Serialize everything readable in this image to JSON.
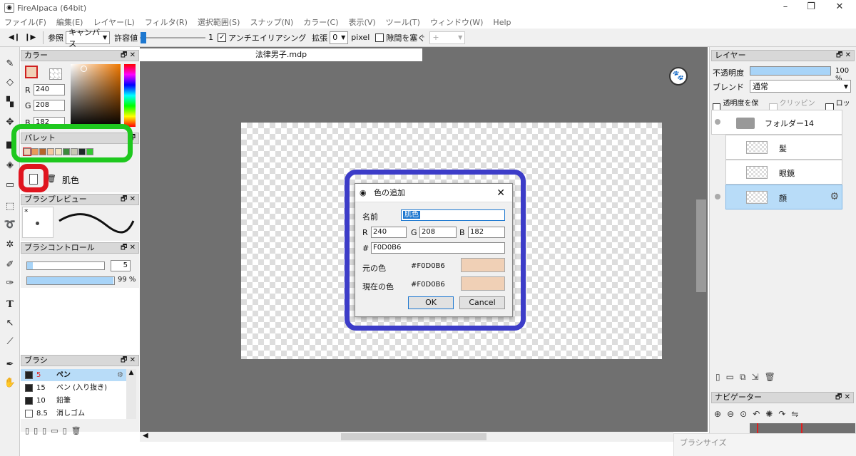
{
  "window": {
    "title": "FireAlpaca (64bit)"
  },
  "menu": [
    "ファイル(F)",
    "編集(E)",
    "レイヤー(L)",
    "フィルタ(R)",
    "選択範囲(S)",
    "スナップ(N)",
    "カラー(C)",
    "表示(V)",
    "ツール(T)",
    "ウィンドウ(W)",
    "Help"
  ],
  "toolbar": {
    "ref_label": "参照",
    "ref_value": "キャンバス",
    "tolerance_label": "許容値",
    "tolerance_value": "1",
    "tolerance_level": 0.01,
    "antialias_label": "アンチエイリアシング",
    "antialias_checked": true,
    "expand_label": "拡張",
    "expand_value": "0",
    "expand_unit": "pixel",
    "gap_label": "隙間を塞ぐ",
    "gap_checked": false,
    "gap_value": "+"
  },
  "document": {
    "tab": "法律男子.mdp"
  },
  "color_panel": {
    "title": "カラー",
    "r_label": "R",
    "r": "240",
    "g_label": "G",
    "g": "208",
    "b_label": "B",
    "b": "182",
    "fg_color": "#F0D0B6"
  },
  "palette_panel": {
    "title": "パレット",
    "colors": [
      "#F0D0B6",
      "#E89A5A",
      "#B5652A",
      "#F5C8A0",
      "#F2E4C0",
      "#3C8A3C",
      "#C8C8B4",
      "#1E2A28",
      "#34C832"
    ],
    "selected_name": "肌色"
  },
  "brush_preview_panel": {
    "title": "ブラシプレビュー",
    "size_mark": "*"
  },
  "brush_control_panel": {
    "title": "ブラシコントロール",
    "size": "5",
    "size_level": 0.05,
    "opacity": "99 %",
    "opacity_level": 0.99
  },
  "brush_panel": {
    "title": "ブラシ",
    "items": [
      {
        "size": "5",
        "name": "ペン",
        "color": "#222222",
        "selected": true
      },
      {
        "size": "15",
        "name": "ペン (入り抜き)",
        "color": "#222222",
        "selected": false
      },
      {
        "size": "10",
        "name": "鉛筆",
        "color": "#222222",
        "selected": false
      },
      {
        "size": "8.5",
        "name": "消しゴム",
        "color": "#ffffff",
        "selected": false
      }
    ]
  },
  "dialog": {
    "title": "色の追加",
    "name_label": "名前",
    "name_value": "肌色",
    "r_label": "R",
    "r": "240",
    "g_label": "G",
    "g": "208",
    "b_label": "B",
    "b": "182",
    "hex_label": "#",
    "hex_value": "F0D0B6",
    "original_label": "元の色",
    "original_value": "#F0D0B6",
    "current_label": "現在の色",
    "current_value": "#F0D0B6",
    "swatch_color": "#F0D0B6",
    "ok": "OK",
    "cancel": "Cancel"
  },
  "layer_panel": {
    "title": "レイヤー",
    "opacity_label": "不透明度",
    "opacity_value": "100 %",
    "opacity_level": 1.0,
    "blend_label": "ブレンド",
    "blend_value": "通常",
    "protect_label": "透明度を保護",
    "clipping_label": "クリッピング",
    "lock_label": "ロック",
    "layers": [
      {
        "name": "フォルダー14",
        "type": "folder"
      },
      {
        "name": "髪",
        "type": "layer"
      },
      {
        "name": "眼鏡",
        "type": "layer"
      },
      {
        "name": "顔",
        "type": "layer",
        "selected": true
      }
    ]
  },
  "navigator_panel": {
    "title": "ナビゲーター"
  },
  "brush_size_panel": {
    "title": "ブラシサイズ"
  },
  "annotations": {
    "green": "#1ec81e",
    "red": "#e0141e",
    "blue": "#3c3cc8"
  }
}
